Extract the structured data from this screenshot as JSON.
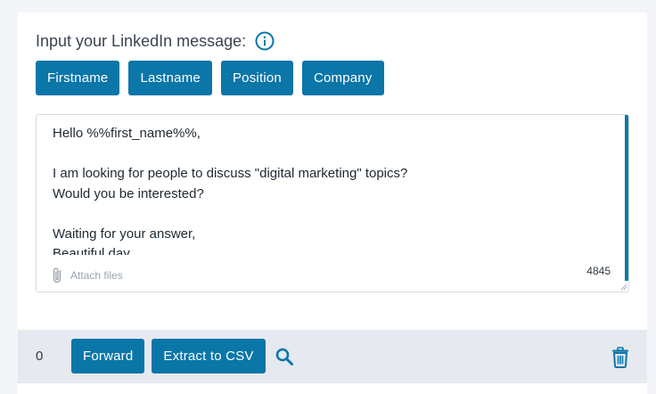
{
  "editor": {
    "heading": "Input your LinkedIn message:",
    "info_icon": "info-circle-icon",
    "tags": [
      "Firstname",
      "Lastname",
      "Position",
      "Company"
    ],
    "message": "Hello %%first_name%%,\n\nI am looking for people to discuss \"digital marketing\" topics?\nWould you be interested?\n\nWaiting for your answer,\nBeautiful day.",
    "attach_label": "Attach files",
    "attach_icon": "paperclip-icon",
    "char_count": "4845"
  },
  "footer": {
    "selected_count": "0",
    "forward_label": "Forward",
    "extract_label": "Extract to CSV",
    "search_icon": "search-icon",
    "delete_icon": "trash-icon"
  },
  "colors": {
    "accent": "#0b76a8",
    "page_bg": "#f4f5f8",
    "footer_bg": "#e6e9ef"
  }
}
